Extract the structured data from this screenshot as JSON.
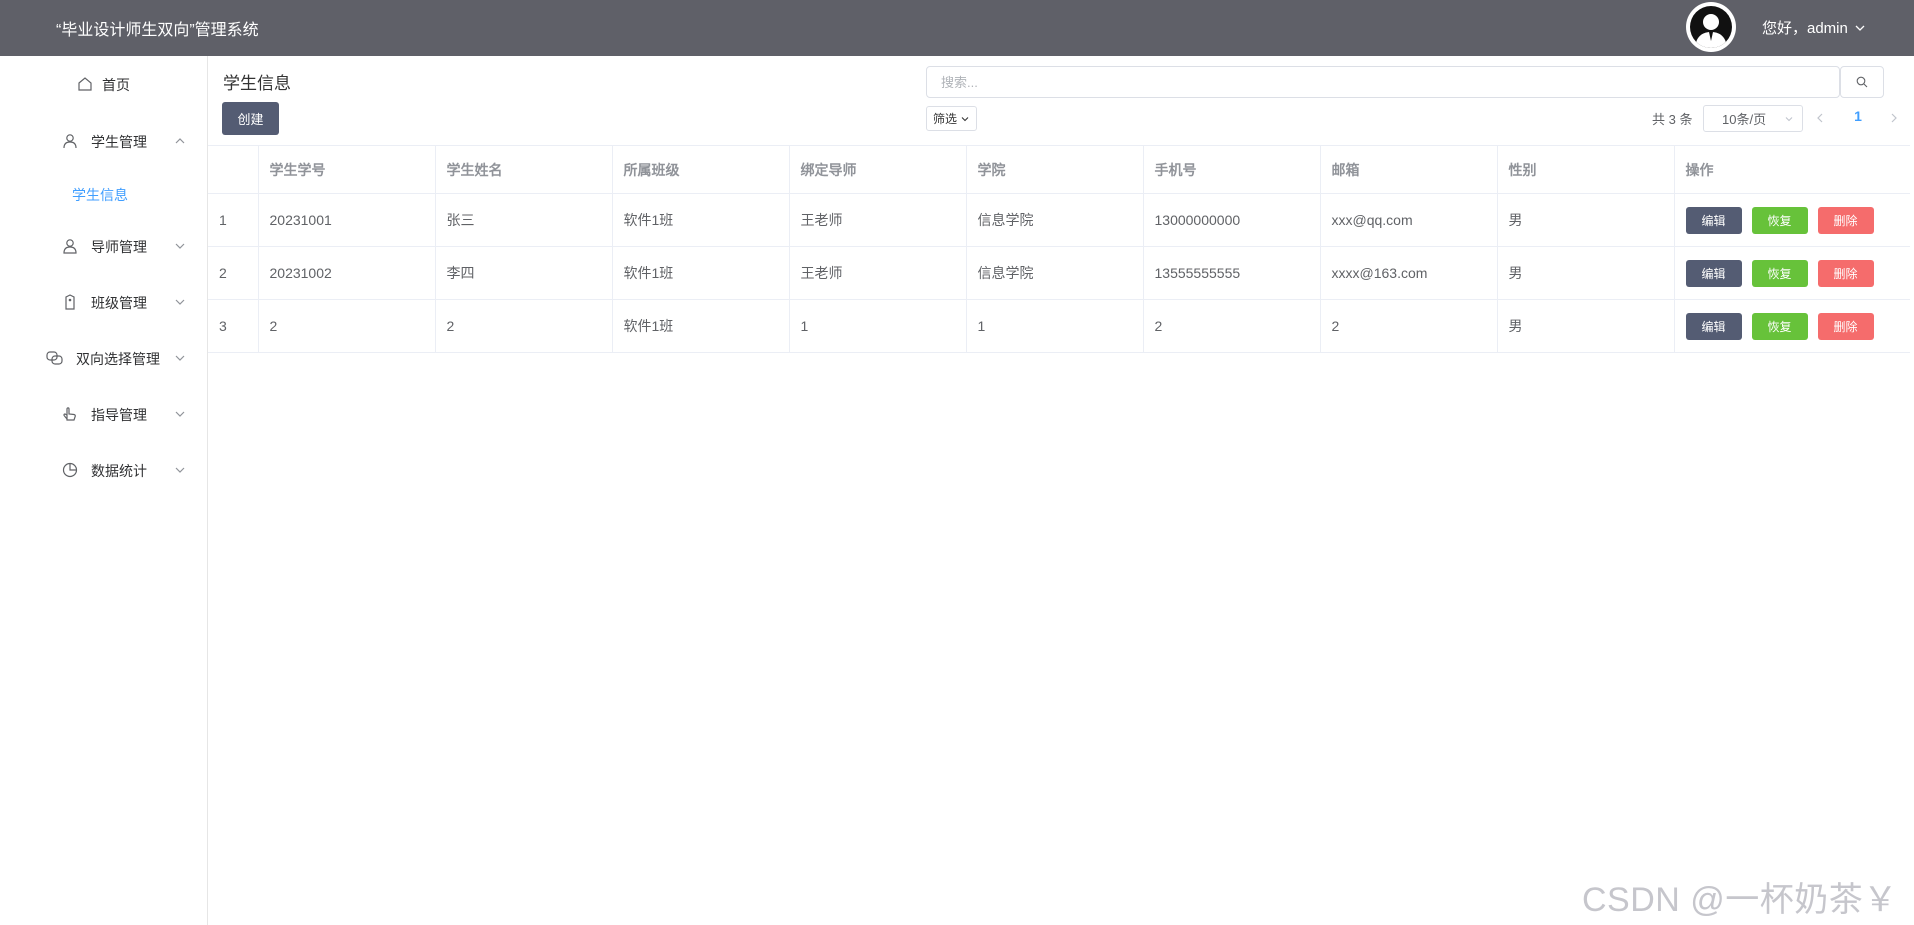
{
  "header": {
    "title": "“毕业设计师生双向”管理系统",
    "user_greeting": "您好，admin"
  },
  "sidebar": {
    "items": [
      {
        "label": "首页",
        "icon": "home-icon"
      },
      {
        "label": "学生管理",
        "icon": "user-icon",
        "expanded": true,
        "children": [
          {
            "label": "学生信息",
            "active": true
          }
        ]
      },
      {
        "label": "导师管理",
        "icon": "teacher-icon"
      },
      {
        "label": "班级管理",
        "icon": "tag-icon"
      },
      {
        "label": "双向选择管理",
        "icon": "link-icon"
      },
      {
        "label": "指导管理",
        "icon": "hand-icon"
      },
      {
        "label": "数据统计",
        "icon": "pie-chart-icon"
      }
    ]
  },
  "main": {
    "title": "学生信息",
    "create_label": "创建",
    "search_placeholder": "搜索...",
    "filter_label": "筛选"
  },
  "pagination": {
    "total": "共 3 条",
    "page_size": "10条/页",
    "current_page": "1"
  },
  "table": {
    "headers": [
      "",
      "学生学号",
      "学生姓名",
      "所属班级",
      "绑定导师",
      "学院",
      "手机号",
      "邮箱",
      "性别",
      "操作"
    ],
    "rows": [
      [
        "1",
        "20231001",
        "张三",
        "软件1班",
        "王老师",
        "信息学院",
        "13000000000",
        "xxx@qq.com",
        "男"
      ],
      [
        "2",
        "20231002",
        "李四",
        "软件1班",
        "王老师",
        "信息学院",
        "13555555555",
        "xxxx@163.com",
        "男"
      ],
      [
        "3",
        "2",
        "2",
        "软件1班",
        "1",
        "1",
        "2",
        "2",
        "男"
      ]
    ],
    "actions": {
      "edit": "编辑",
      "restore": "恢复",
      "delete": "删除"
    }
  },
  "watermark": "CSDN @一杯奶茶￥",
  "colors": {
    "header_bg": "#5f6068",
    "primary_dark": "#545c73",
    "success": "#67c23a",
    "danger": "#f56c6c",
    "link": "#409eff"
  }
}
